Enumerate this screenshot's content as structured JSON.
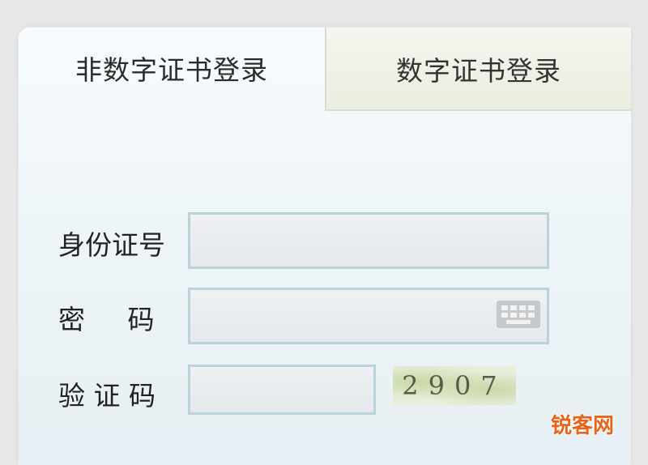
{
  "tabs": [
    {
      "label": "非数字证书登录",
      "active": true
    },
    {
      "label": "数字证书登录",
      "active": false
    }
  ],
  "form": {
    "id_label": "身份证号",
    "id_value": "",
    "password_label": "密     码",
    "password_value": "",
    "captcha_label": "验 证 码",
    "captcha_value": "",
    "captcha_image_text": "2907",
    "keyboard_icon": "keyboard-icon"
  },
  "watermark": "锐客网",
  "colors": {
    "field_border": "#b8d3da",
    "watermark": "#e8641a"
  }
}
